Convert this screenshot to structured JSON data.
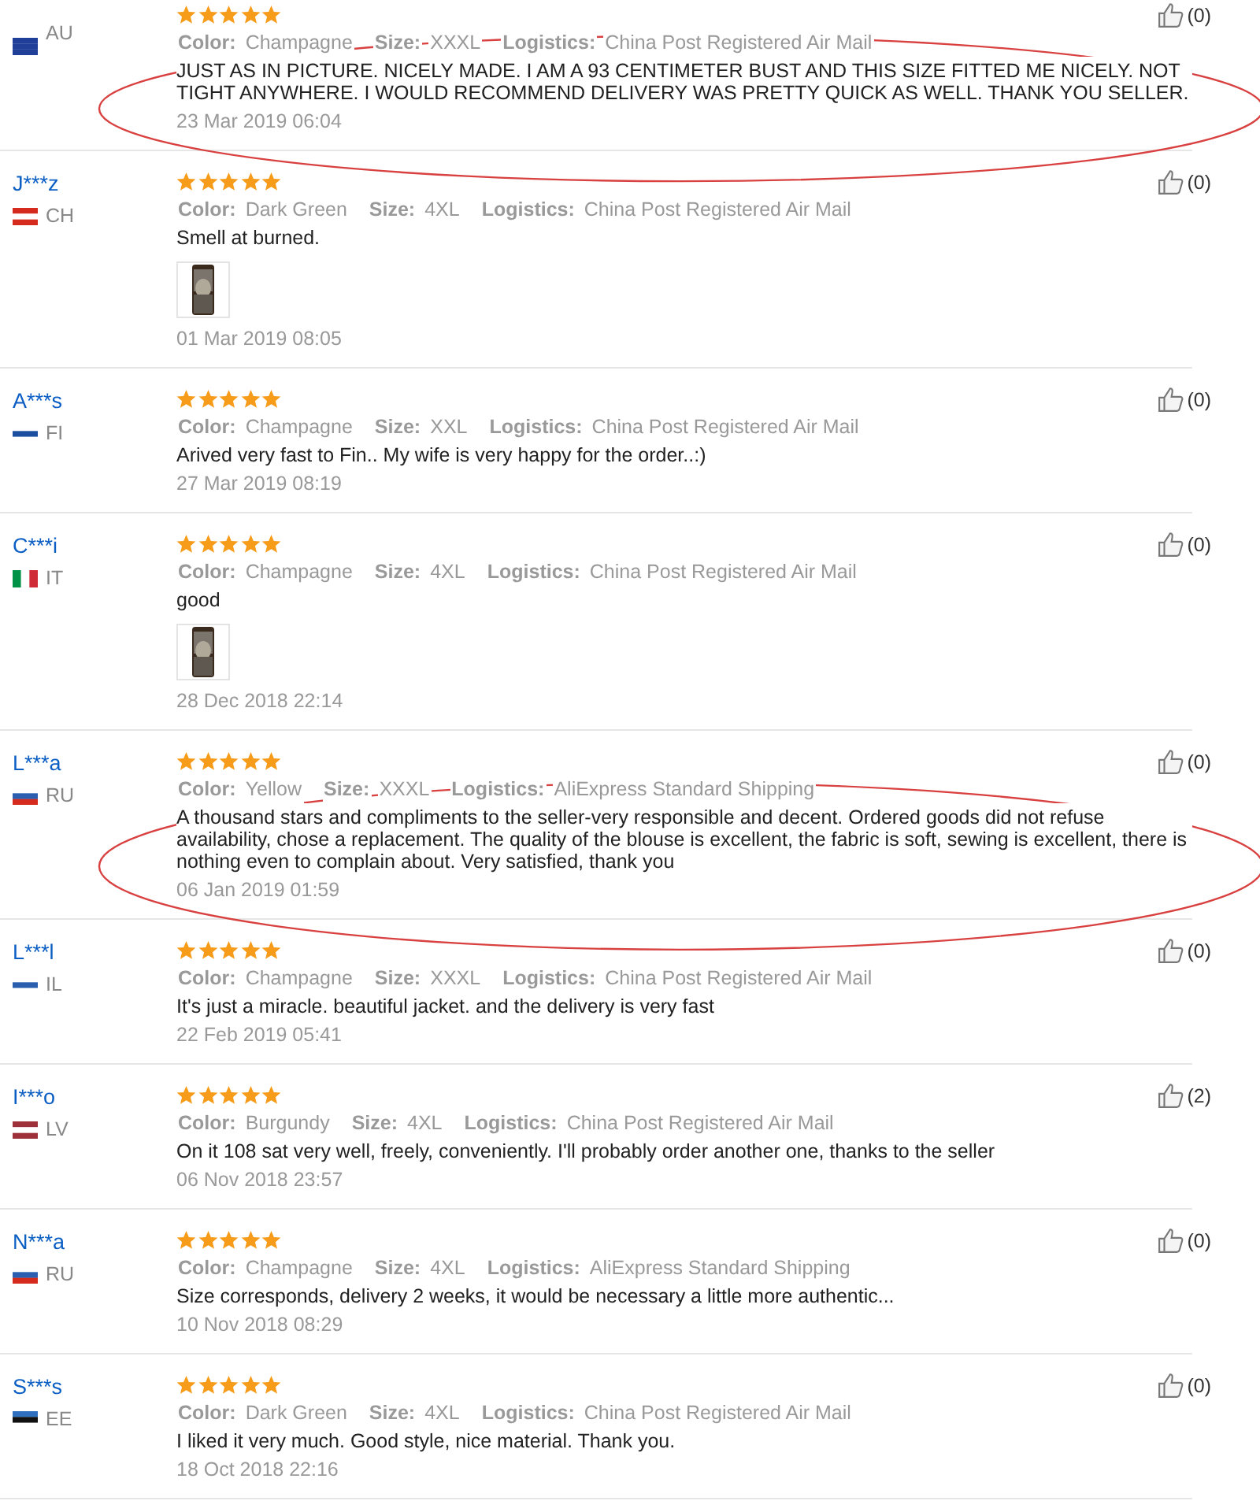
{
  "reviews": [
    {
      "country": "AU",
      "flag": {
        "kind": "horizontal",
        "stripes": [
          {
            "color": "#1f3f99"
          },
          {
            "color": "#1f3f99"
          },
          {
            "color": "#1f3f99"
          }
        ]
      },
      "stars": 5,
      "color_label": "Color:",
      "item_color": "Champagne",
      "size_label": "Size:",
      "size": "XXXL",
      "logistics_label": "Logistics:",
      "logistics": "China Post Registered Air Mail",
      "comment": "JUST AS IN PICTURE. NICELY MADE. I AM A 93 CENTIMETER BUST AND THIS SIZE FITTED ME NICELY. NOT TIGHT ANYWHERE. I WOULD RECOMMEND DELIVERY WAS PRETTY QUICK AS WELL. THANK YOU SELLER.",
      "date": "23 Mar 2019 06:04",
      "likes": "(0)",
      "highlighted": true
    },
    {
      "name": "J***z",
      "country": "CH",
      "flag": {
        "kind": "horizontal",
        "stripes": [
          {
            "color": "#d52b1e"
          },
          {
            "color": "#ffffff"
          },
          {
            "color": "#d52b1e"
          }
        ]
      },
      "stars": 5,
      "color_label": "Color:",
      "item_color": "Dark Green",
      "size_label": "Size:",
      "size": "4XL",
      "logistics_label": "Logistics:",
      "logistics": "China Post Registered Air Mail",
      "comment": "Smell at burned.",
      "photos": [
        {
          "kind": "picture"
        }
      ],
      "date": "01 Mar 2019 08:05",
      "likes": "(0)",
      "highlighted": false
    },
    {
      "name": "A***s",
      "country": "FI",
      "flag": {
        "kind": "horizontal",
        "stripes": [
          {
            "color": "#ffffff"
          },
          {
            "color": "#1a4fa0"
          },
          {
            "color": "#ffffff"
          }
        ]
      },
      "stars": 5,
      "color_label": "Color:",
      "item_color": "Champagne",
      "size_label": "Size:",
      "size": "XXL",
      "logistics_label": "Logistics:",
      "logistics": "China Post Registered Air Mail",
      "comment": "Arived very fast to Fin.. My wife is very happy for the order..:)",
      "date": "27 Mar 2019 08:19",
      "likes": "(0)",
      "highlighted": false
    },
    {
      "name": "C***i",
      "country": "IT",
      "flag": {
        "kind": "vertical",
        "stripes": [
          {
            "color": "#009246"
          },
          {
            "color": "#ffffff"
          },
          {
            "color": "#ce2b37"
          }
        ]
      },
      "stars": 5,
      "color_label": "Color:",
      "item_color": "Champagne",
      "size_label": "Size:",
      "size": "4XL",
      "logistics_label": "Logistics:",
      "logistics": "China Post Registered Air Mail",
      "comment": "good",
      "photos": [
        {
          "kind": "picture"
        }
      ],
      "date": "28 Dec 2018 22:14",
      "likes": "(0)",
      "highlighted": false
    },
    {
      "name": "L***a",
      "country": "RU",
      "flag": {
        "kind": "horizontal",
        "stripes": [
          {
            "color": "#ffffff"
          },
          {
            "color": "#2a5fb0"
          },
          {
            "color": "#d52b1e"
          }
        ]
      },
      "stars": 5,
      "color_label": "Color:",
      "item_color": "Yellow",
      "size_label": "Size:",
      "size": "XXXL",
      "logistics_label": "Logistics:",
      "logistics": "AliExpress Standard Shipping",
      "comment": "A thousand stars and compliments to the seller-very responsible and decent. Ordered goods did not refuse availability, chose a replacement. The quality of the blouse is excellent, the fabric is soft, sewing is excellent, there is nothing even to complain about. Very satisfied, thank you",
      "date": "06 Jan 2019 01:59",
      "likes": "(0)",
      "highlighted": true
    },
    {
      "name": "L***l",
      "country": "IL",
      "flag": {
        "kind": "horizontal",
        "stripes": [
          {
            "color": "#ffffff"
          },
          {
            "color": "#2a5fb0"
          },
          {
            "color": "#ffffff"
          }
        ]
      },
      "stars": 5,
      "color_label": "Color:",
      "item_color": "Champagne",
      "size_label": "Size:",
      "size": "XXXL",
      "logistics_label": "Logistics:",
      "logistics": "China Post Registered Air Mail",
      "comment": "It's just a miracle. beautiful jacket. and the delivery is very fast",
      "date": "22 Feb 2019 05:41",
      "likes": "(0)",
      "highlighted": false
    },
    {
      "name": "I***o",
      "country": "LV",
      "flag": {
        "kind": "horizontal",
        "stripes": [
          {
            "color": "#9e3039"
          },
          {
            "color": "#ffffff"
          },
          {
            "color": "#9e3039"
          }
        ]
      },
      "stars": 5,
      "color_label": "Color:",
      "item_color": "Burgundy",
      "size_label": "Size:",
      "size": "4XL",
      "logistics_label": "Logistics:",
      "logistics": "China Post Registered Air Mail",
      "comment": "On it 108 sat very well, freely, conveniently. I'll probably order another one, thanks to the seller",
      "date": "06 Nov 2018 23:57",
      "likes": "(2)",
      "highlighted": false
    },
    {
      "name": "N***a",
      "country": "RU",
      "flag": {
        "kind": "horizontal",
        "stripes": [
          {
            "color": "#ffffff"
          },
          {
            "color": "#2a5fb0"
          },
          {
            "color": "#d52b1e"
          }
        ]
      },
      "stars": 5,
      "color_label": "Color:",
      "item_color": "Champagne",
      "size_label": "Size:",
      "size": "4XL",
      "logistics_label": "Logistics:",
      "logistics": "AliExpress Standard Shipping",
      "comment": "Size corresponds, delivery 2 weeks, it would be necessary a little more authentic...",
      "date": "10 Nov 2018 08:29",
      "likes": "(0)",
      "highlighted": false
    },
    {
      "name": "S***s",
      "country": "EE",
      "flag": {
        "kind": "horizontal",
        "stripes": [
          {
            "color": "#2f6fc0"
          },
          {
            "color": "#111111"
          },
          {
            "color": "#ffffff"
          }
        ]
      },
      "stars": 5,
      "color_label": "Color:",
      "item_color": "Dark Green",
      "size_label": "Size:",
      "size": "4XL",
      "logistics_label": "Logistics:",
      "logistics": "China Post Registered Air Mail",
      "comment": "I liked it very much. Good style, nice material. Thank you.",
      "date": "18 Oct 2018 22:16",
      "likes": "(0)",
      "highlighted": false
    }
  ]
}
